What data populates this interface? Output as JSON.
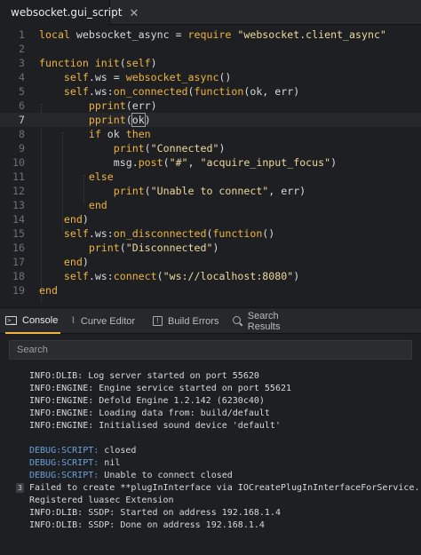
{
  "tab": {
    "title": "websocket.gui_script",
    "close": "✕"
  },
  "editor": {
    "active_line": 7,
    "lines": [
      {
        "n": "1",
        "segs": [
          [
            "kw",
            "local"
          ],
          [
            "plain",
            " websocket_async = "
          ],
          [
            "kw",
            "require"
          ],
          [
            "plain",
            " "
          ],
          [
            "str",
            "\"websocket.client_async\""
          ]
        ]
      },
      {
        "n": "2",
        "segs": []
      },
      {
        "n": "3",
        "segs": [
          [
            "kw",
            "function"
          ],
          [
            "plain",
            " "
          ],
          [
            "fn",
            "init"
          ],
          [
            "plain",
            "("
          ],
          [
            "self",
            "self"
          ],
          [
            "plain",
            ")"
          ]
        ]
      },
      {
        "n": "4",
        "segs": [
          [
            "plain",
            "    "
          ],
          [
            "self",
            "self"
          ],
          [
            "plain",
            ".ws = "
          ],
          [
            "fn",
            "websocket_async"
          ],
          [
            "plain",
            "()"
          ]
        ]
      },
      {
        "n": "5",
        "segs": [
          [
            "plain",
            "    "
          ],
          [
            "self",
            "self"
          ],
          [
            "plain",
            ".ws:"
          ],
          [
            "fn",
            "on_connected"
          ],
          [
            "plain",
            "("
          ],
          [
            "kw",
            "function"
          ],
          [
            "plain",
            "(ok, err)"
          ]
        ]
      },
      {
        "n": "6",
        "segs": [
          [
            "plain",
            "        "
          ],
          [
            "fn",
            "pprint"
          ],
          [
            "plain",
            "(err)"
          ]
        ]
      },
      {
        "n": "7",
        "segs": [
          [
            "plain",
            "        "
          ],
          [
            "fn",
            "pprint"
          ],
          [
            "plain",
            "("
          ],
          [
            "cursor",
            "ok"
          ],
          [
            "plain",
            ")"
          ]
        ]
      },
      {
        "n": "8",
        "segs": [
          [
            "plain",
            "        "
          ],
          [
            "kw",
            "if"
          ],
          [
            "plain",
            " ok "
          ],
          [
            "kw",
            "then"
          ]
        ]
      },
      {
        "n": "9",
        "segs": [
          [
            "plain",
            "            "
          ],
          [
            "fn",
            "print"
          ],
          [
            "plain",
            "("
          ],
          [
            "str",
            "\"Connected\""
          ],
          [
            "plain",
            ")"
          ]
        ]
      },
      {
        "n": "10",
        "segs": [
          [
            "plain",
            "            msg."
          ],
          [
            "fn",
            "post"
          ],
          [
            "plain",
            "("
          ],
          [
            "str",
            "\"#\""
          ],
          [
            "plain",
            ", "
          ],
          [
            "str",
            "\"acquire_input_focus\""
          ],
          [
            "plain",
            ")"
          ]
        ]
      },
      {
        "n": "11",
        "segs": [
          [
            "plain",
            "        "
          ],
          [
            "kw",
            "else"
          ]
        ]
      },
      {
        "n": "12",
        "segs": [
          [
            "plain",
            "            "
          ],
          [
            "fn",
            "print"
          ],
          [
            "plain",
            "("
          ],
          [
            "str",
            "\"Unable to connect\""
          ],
          [
            "plain",
            ", err)"
          ]
        ]
      },
      {
        "n": "13",
        "segs": [
          [
            "plain",
            "        "
          ],
          [
            "kw",
            "end"
          ]
        ]
      },
      {
        "n": "14",
        "segs": [
          [
            "plain",
            "    "
          ],
          [
            "kw",
            "end"
          ],
          [
            "plain",
            ")"
          ]
        ]
      },
      {
        "n": "15",
        "segs": [
          [
            "plain",
            "    "
          ],
          [
            "self",
            "self"
          ],
          [
            "plain",
            ".ws:"
          ],
          [
            "fn",
            "on_disconnected"
          ],
          [
            "plain",
            "("
          ],
          [
            "kw",
            "function"
          ],
          [
            "plain",
            "()"
          ]
        ]
      },
      {
        "n": "16",
        "segs": [
          [
            "plain",
            "        "
          ],
          [
            "fn",
            "print"
          ],
          [
            "plain",
            "("
          ],
          [
            "str",
            "\"Disconnected\""
          ],
          [
            "plain",
            ")"
          ]
        ]
      },
      {
        "n": "17",
        "segs": [
          [
            "plain",
            "    "
          ],
          [
            "kw",
            "end"
          ],
          [
            "plain",
            ")"
          ]
        ]
      },
      {
        "n": "18",
        "segs": [
          [
            "plain",
            "    "
          ],
          [
            "self",
            "self"
          ],
          [
            "plain",
            ".ws:"
          ],
          [
            "fn",
            "connect"
          ],
          [
            "plain",
            "("
          ],
          [
            "str",
            "\"ws://localhost:8080\""
          ],
          [
            "plain",
            ")"
          ]
        ]
      },
      {
        "n": "19",
        "segs": [
          [
            "kw",
            "end"
          ]
        ]
      }
    ]
  },
  "panel": {
    "tabs": [
      {
        "label": "Console",
        "icon": "console-icon",
        "active": true
      },
      {
        "label": "Curve Editor",
        "icon": "curve-icon",
        "active": false
      },
      {
        "label": "Build Errors",
        "icon": "build-errors-icon",
        "active": false
      },
      {
        "label": "Search Results",
        "icon": "search-icon",
        "active": false
      }
    ],
    "search_placeholder": "Search"
  },
  "console": {
    "lines": [
      {
        "type": "info",
        "text": "INFO:DLIB: Log server started on port 55620"
      },
      {
        "type": "info",
        "text": "INFO:ENGINE: Engine service started on port 55621"
      },
      {
        "type": "info",
        "text": "INFO:ENGINE: Defold Engine 1.2.142 (6230c40)"
      },
      {
        "type": "info",
        "text": "INFO:ENGINE: Loading data from: build/default"
      },
      {
        "type": "info",
        "text": "INFO:ENGINE: Initialised sound device 'default'"
      },
      {
        "type": "blank",
        "text": ""
      },
      {
        "type": "debug",
        "prefix": "DEBUG:SCRIPT:",
        "text": " closed"
      },
      {
        "type": "debug",
        "prefix": "DEBUG:SCRIPT:",
        "text": " nil"
      },
      {
        "type": "debug",
        "prefix": "DEBUG:SCRIPT:",
        "text": " Unable to connect closed"
      },
      {
        "type": "info",
        "badge": "3",
        "text": "Failed to create **plugInInterface via IOCreatePlugInInterfaceForService."
      },
      {
        "type": "info",
        "text": "Registered luasec Extension"
      },
      {
        "type": "info",
        "text": "INFO:DLIB: SSDP: Started on address 192.168.1.4"
      },
      {
        "type": "info",
        "text": "INFO:DLIB: SSDP: Done on address 192.168.1.4"
      }
    ]
  },
  "colors": {
    "accent": "#f0b43c",
    "debug": "#6aa0d8",
    "background": "#1d1f22"
  }
}
